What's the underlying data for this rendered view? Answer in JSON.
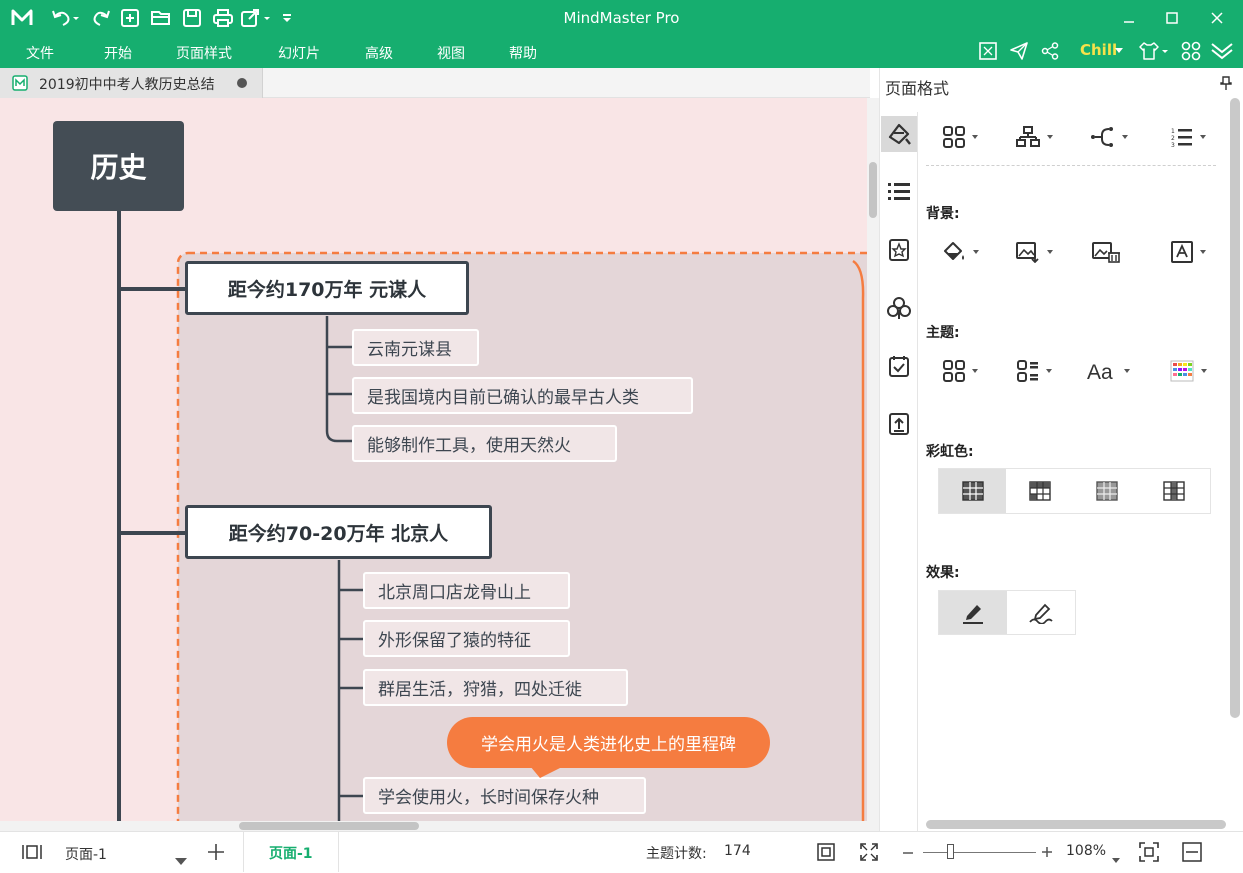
{
  "app": {
    "title": "MindMaster Pro",
    "accent_color": "#16ae6f",
    "theme_name": "Chill"
  },
  "quick_access": [
    {
      "name": "logo-icon"
    },
    {
      "name": "undo-icon"
    },
    {
      "name": "redo-icon"
    },
    {
      "name": "new-icon"
    },
    {
      "name": "open-folder-icon"
    },
    {
      "name": "save-icon"
    },
    {
      "name": "print-icon"
    },
    {
      "name": "export-icon"
    },
    {
      "name": "customize-icon"
    }
  ],
  "menu": [
    "文件",
    "开始",
    "页面样式",
    "幻灯片",
    "高级",
    "视图",
    "帮助"
  ],
  "doc_tab": {
    "title": "2019初中中考人教历史总结"
  },
  "mindmap": {
    "root": "历史",
    "root_color": "#444d55",
    "boundary_color": "#f57c40",
    "topics": [
      {
        "title": "距今约170万年  元谋人",
        "subtopics": [
          "云南元谋县",
          "是我国境内目前已确认的最早古人类",
          "能够制作工具，使用天然火"
        ]
      },
      {
        "title": "距今约70-20万年  北京人",
        "subtopics": [
          "北京周口店龙骨山上",
          "外形保留了猿的特征",
          "群居生活，狩猎，四处迁徙",
          "学会使用火，长时间保存火种"
        ]
      }
    ],
    "callout": "学会用火是人类进化史上的里程碑"
  },
  "panel": {
    "title": "页面格式",
    "sections": {
      "background": "背景:",
      "theme": "主题:",
      "rainbow": "彩虹色:",
      "effect": "效果:"
    }
  },
  "status": {
    "page_select": "页面-1",
    "page_tab": "页面-1",
    "topic_count_label": "主题计数:",
    "topic_count": "174",
    "zoom": "108%"
  }
}
